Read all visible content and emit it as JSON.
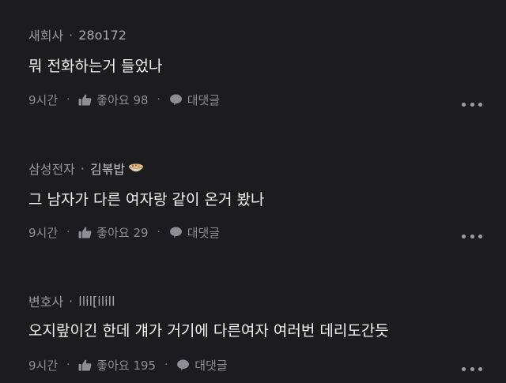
{
  "comments": [
    {
      "company": "새회사",
      "nickname": "28o172",
      "text": "뭐 전화하는거 들었나",
      "time": "9시간",
      "like_label": "좋아요 98",
      "reply_label": "대댓글"
    },
    {
      "company": "삼성전자",
      "nickname": "김볶밥",
      "text": "그 남자가 다른 여자랑 같이 온거 봤나",
      "time": "9시간",
      "like_label": "좋아요 29",
      "reply_label": "대댓글"
    },
    {
      "company": "변호사",
      "nickname": "llil[ilill",
      "text": "오지랖이긴 한데 걔가 거기에 다른여자 여러번 데리도간듯",
      "time": "9시간",
      "like_label": "좋아요 195",
      "reply_label": "대댓글"
    }
  ],
  "separator": "·",
  "icons": {
    "like": "thumbs-up-icon",
    "reply": "speech-bubble-icon",
    "more": "more-dots-icon",
    "nickname_badge": "rice-bowl-icon"
  },
  "colors": {
    "background": "#1c1c1e",
    "text": "#f2f2f2",
    "muted": "#9a9a9e"
  }
}
